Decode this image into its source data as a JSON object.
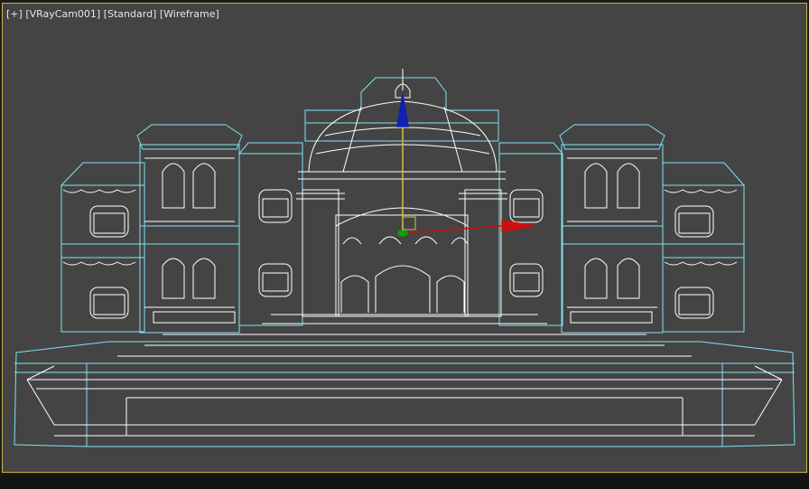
{
  "viewport": {
    "label_parts": [
      "[+]",
      "[VRayCam001]",
      "[Standard]",
      "[Wireframe]"
    ],
    "active_border_color": "#c9b44a",
    "background_color": "#444444",
    "wire_color_selected": "#7fe3f2",
    "wire_color": "#ffffff"
  },
  "gizmo": {
    "icon": "move-gizmo-icon",
    "axis_colors": {
      "x": "#cc1010",
      "y": "#10a010",
      "z": "#1020b0"
    }
  }
}
